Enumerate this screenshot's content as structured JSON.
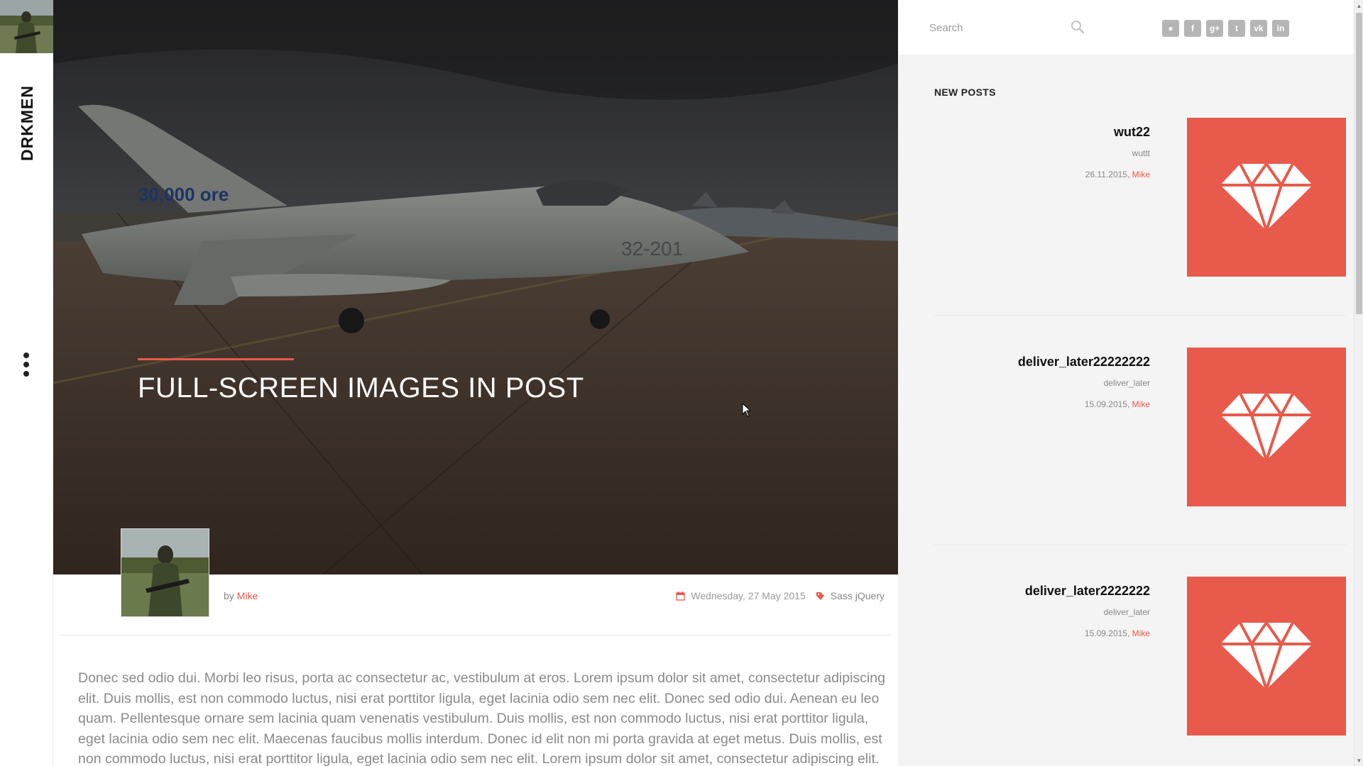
{
  "brand": {
    "name": "DRKMEN"
  },
  "hero": {
    "title": "FULL-SCREEN IMAGES IN POST"
  },
  "post_meta": {
    "by": "by",
    "author": "Mike",
    "date": "Wednesday, 27 May 2015",
    "tags": "Sass jQuery"
  },
  "body_text": "Donec sed odio dui. Morbi leo risus, porta ac consectetur ac, vestibulum at eros. Lorem ipsum dolor sit amet, consectetur adipiscing elit. Duis mollis, est non commodo luctus, nisi erat porttitor ligula, eget lacinia odio sem nec elit. Donec sed odio dui. Aenean eu leo quam. Pellentesque ornare sem lacinia quam venenatis vestibulum. Duis mollis, est non commodo luctus, nisi erat porttitor ligula, eget lacinia odio sem nec elit. Maecenas faucibus mollis interdum. Donec id elit non mi porta gravida at eget metus. Duis mollis, est non commodo luctus, nisi erat porttitor ligula, eget lacinia odio sem nec elit. Lorem ipsum dolor sit amet, consectetur adipiscing elit.",
  "sidebar": {
    "search_placeholder": "Search",
    "social_icons": [
      {
        "icon": "github-icon",
        "glyph": "●"
      },
      {
        "icon": "facebook-icon",
        "glyph": "f"
      },
      {
        "icon": "google-plus-icon",
        "glyph": "g+"
      },
      {
        "icon": "twitter-icon",
        "glyph": "t"
      },
      {
        "icon": "vk-icon",
        "glyph": "vk"
      },
      {
        "icon": "linkedin-icon",
        "glyph": "in"
      }
    ],
    "new_posts_heading": "NEW POSTS",
    "posts": [
      {
        "title": "wut22",
        "excerpt": "wuttt",
        "date": "26.11.2015,",
        "author": "Mike"
      },
      {
        "title": "deliver_later22222222",
        "excerpt": "deliver_later",
        "date": "15.09.2015,",
        "author": "Mike"
      },
      {
        "title": "deliver_later2222222",
        "excerpt": "deliver_later",
        "date": "15.09.2015,",
        "author": "Mike"
      }
    ]
  },
  "colors": {
    "accent": "#e55a4c",
    "thumb_bg": "#e85a4b",
    "panel_bg": "#f4f4f4"
  }
}
